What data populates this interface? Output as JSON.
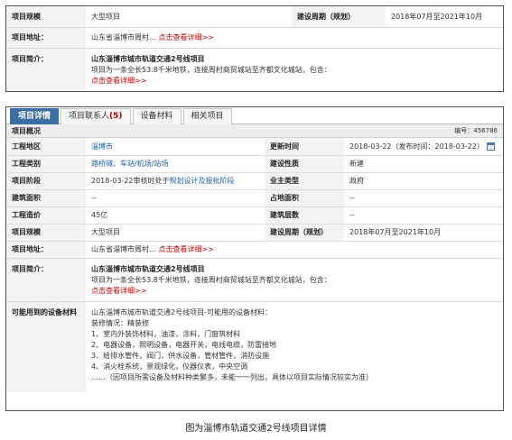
{
  "top": {
    "scale_label": "项目规模",
    "scale_value": "大型项目",
    "period_label": "建设周期（规划）",
    "period_value": "2018年07月至2021年10月",
    "address_label": "项目地址：",
    "address_value": "山东省淄博市周村…",
    "address_link": "点击查看详细>>",
    "intro_label": "项目简介：",
    "intro_title": "山东淄博市城市轨道交通2号线项目",
    "intro_text": "项目为一条全长53.8千米地铁，连接周村商贸城站至齐都文化城站，包含：",
    "intro_link": "点击查看详细>>"
  },
  "tabs": [
    {
      "label": "项目详情",
      "active": true
    },
    {
      "label": "项目联系人",
      "count": "(5)"
    },
    {
      "label": "设备材料"
    },
    {
      "label": "相关项目"
    }
  ],
  "overview": {
    "title": "项目概况",
    "number": "编号：456786"
  },
  "details": {
    "location_label": "工程地区",
    "location_value": "淄博市",
    "updated_label": "更新时间",
    "updated_value": "2018-03-22（发布时间：2018-03-22）",
    "category_label": "工程类别",
    "category_value": "路桥隧、车站/机场/站场",
    "nature_label": "建设性质",
    "nature_value": "新建",
    "stage_label": "项目阶段",
    "stage_prefix": "2018-03-22审核时处于",
    "stage_value": "规划设计及报批阶段",
    "owner_label": "业主类型",
    "owner_value": "政府",
    "area_label": "建筑面积",
    "area_value": "--",
    "land_label": "占地面积",
    "land_value": "--",
    "cost_label": "工程造价",
    "cost_value": "45亿",
    "floors_label": "建筑层数",
    "floors_value": "--",
    "scale_label": "项目规模",
    "scale_value": "大型项目",
    "period_label": "建设周期（规划）",
    "period_value": "2018年07月至2021年10月",
    "address_label": "项目地址：",
    "address_value": "山东省淄博市周村…",
    "address_link": "点击查看详细>>",
    "intro_label": "项目简介：",
    "intro_title": "山东淄博市城市轨道交通2号线项目",
    "intro_text": "项目为一条全长53.8千米地铁，连接周村商贸城站至齐都文化城站，包含：",
    "intro_link": "点击查看详细>>",
    "materials_label": "可能用到的设备材料",
    "materials_lines": [
      "山东淄博市城市轨道交通2号线项目-可能用的设备材料：",
      "装修情况：精装修",
      "1、室内外装饰材料，油漆，涂料，门窗筑材料",
      "2、电器设备，照明设备，电器开关，电线电缆，防雷接地",
      "3、给排水管件，阀门，供水设备，管材管件，消防设施",
      "4、消火栓系统，景观绿化，仪器仪表，中央空调",
      "……（因项目所需设备及材料种类繁多，未能一一列出，具体以项目实际情况较实为准）"
    ]
  },
  "caption": "图为淄博市轨道交通2号线项目详情"
}
